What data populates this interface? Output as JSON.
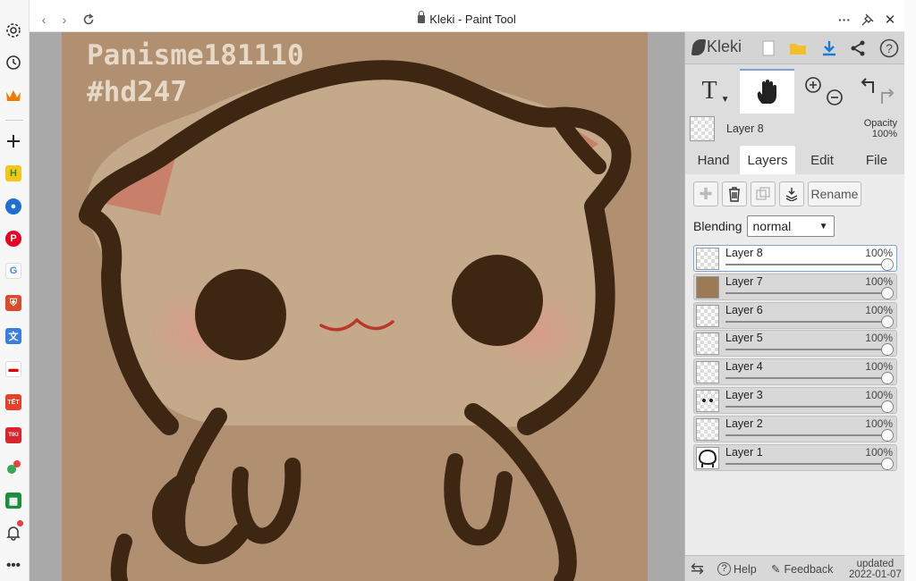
{
  "window": {
    "title": "Kleki - Paint Tool",
    "more_icon": "ellipsis-icon",
    "pin_icon": "pin-icon",
    "close_icon": "close-icon"
  },
  "sidebar": {
    "items": [
      {
        "name": "settings",
        "icon": "gear-icon"
      },
      {
        "name": "history",
        "icon": "history-icon"
      },
      {
        "name": "crown-app",
        "icon": "crown-icon"
      },
      {
        "name": "add",
        "icon": "plus-icon"
      },
      {
        "name": "habitica",
        "icon": "H"
      },
      {
        "name": "app2",
        "icon": "app-icon"
      },
      {
        "name": "pinterest",
        "icon": "P"
      },
      {
        "name": "google",
        "icon": "G"
      },
      {
        "name": "shield-app",
        "icon": "shield-icon"
      },
      {
        "name": "translate",
        "icon": "translate-icon"
      },
      {
        "name": "news",
        "icon": "news-icon"
      },
      {
        "name": "tet-shop",
        "icon": "TẾT"
      },
      {
        "name": "tiki",
        "icon": "TIKI"
      },
      {
        "name": "maps",
        "icon": "map-icon"
      },
      {
        "name": "sheets",
        "icon": "sheets-icon"
      },
      {
        "name": "notifications",
        "icon": "bell-icon"
      },
      {
        "name": "more",
        "icon": "ellipsis-icon"
      }
    ]
  },
  "canvas": {
    "watermark_line1": "Panisme181110",
    "watermark_line2": "#hd247"
  },
  "panel": {
    "logo": "Kleki",
    "current_layer": {
      "name": "Layer 8",
      "opacity_label": "Opacity",
      "opacity_value": "100%"
    },
    "tabs": [
      {
        "label": "Hand",
        "active": false
      },
      {
        "label": "Layers",
        "active": true
      },
      {
        "label": "Edit",
        "active": false
      },
      {
        "label": "File",
        "active": false
      }
    ],
    "rename_label": "Rename",
    "blending_label": "Blending",
    "blending_value": "normal",
    "layers": [
      {
        "name": "Layer 8",
        "opacity": "100%",
        "active": true
      },
      {
        "name": "Layer 7",
        "opacity": "100%",
        "active": false
      },
      {
        "name": "Layer 6",
        "opacity": "100%",
        "active": false
      },
      {
        "name": "Layer 5",
        "opacity": "100%",
        "active": false
      },
      {
        "name": "Layer 4",
        "opacity": "100%",
        "active": false
      },
      {
        "name": "Layer 3",
        "opacity": "100%",
        "active": false
      },
      {
        "name": "Layer 2",
        "opacity": "100%",
        "active": false
      },
      {
        "name": "Layer 1",
        "opacity": "100%",
        "active": false
      }
    ],
    "footer": {
      "help": "Help",
      "feedback": "Feedback",
      "updated_label": "updated",
      "updated_date": "2022-01-07"
    }
  },
  "colors": {
    "canvas_bg": "#b09070",
    "outline": "#3d2712",
    "accent": "#1a7bd6"
  }
}
